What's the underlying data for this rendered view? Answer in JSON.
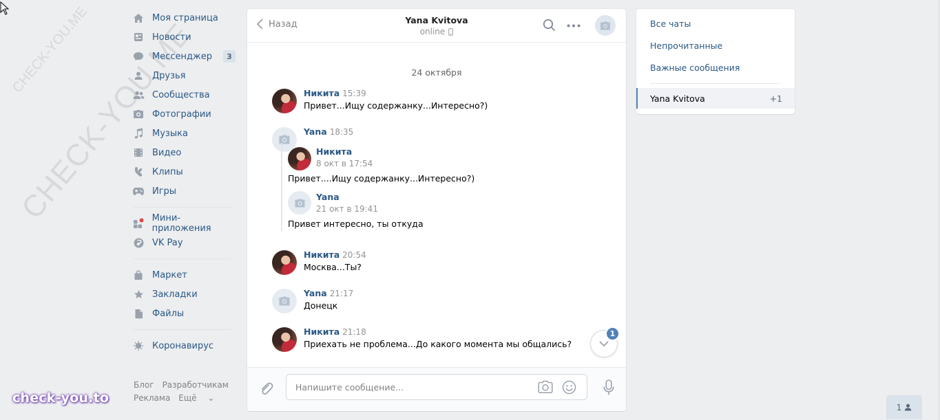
{
  "watermark": {
    "small": "CHECK-YOU.ME",
    "large": "CHECK-YOU.ME",
    "bottom": "check-you.to"
  },
  "nav": {
    "items": [
      {
        "label": "Моя страница",
        "icon": "home-icon"
      },
      {
        "label": "Новости",
        "icon": "news-icon"
      },
      {
        "label": "Мессенджер",
        "icon": "messenger-icon",
        "badge": "3"
      },
      {
        "label": "Друзья",
        "icon": "friends-icon"
      },
      {
        "label": "Сообщества",
        "icon": "communities-icon"
      },
      {
        "label": "Фотографии",
        "icon": "photos-icon"
      },
      {
        "label": "Музыка",
        "icon": "music-icon"
      },
      {
        "label": "Видео",
        "icon": "video-icon"
      },
      {
        "label": "Клипы",
        "icon": "clips-icon"
      },
      {
        "label": "Игры",
        "icon": "games-icon"
      }
    ],
    "items2": [
      {
        "label": "Мини-приложения",
        "icon": "mini-apps-icon"
      },
      {
        "label": "VK Pay",
        "icon": "vkpay-icon"
      }
    ],
    "items3": [
      {
        "label": "Маркет",
        "icon": "market-icon"
      },
      {
        "label": "Закладки",
        "icon": "bookmarks-icon"
      },
      {
        "label": "Файлы",
        "icon": "files-icon"
      }
    ],
    "items4": [
      {
        "label": "Коронавирус",
        "icon": "coronavirus-icon"
      }
    ],
    "footer": {
      "blog": "Блог",
      "developers": "Разработчикам",
      "ads": "Реклама",
      "more": "Ещё"
    }
  },
  "chat": {
    "back_label": "Назад",
    "peer_name": "Yana Kvitova",
    "peer_status": "online",
    "date_separator": "24 октября",
    "messages": [
      {
        "author": "Никита",
        "time": "15:39",
        "text": "Привет...Ищу содержанку...Интересно?)"
      },
      {
        "author": "Yana",
        "time": "18:35",
        "text": ""
      },
      {
        "author": "Никита",
        "time": "20:54",
        "text": "Москва...Ты?"
      },
      {
        "author": "Yana",
        "time": "21:17",
        "text": "Донецк"
      },
      {
        "author": "Никита",
        "time": "21:18",
        "text": "Приехать не проблема...До какого момента мы общались?"
      }
    ],
    "forwarded": [
      {
        "author": "Никита",
        "date": "8 окт в 17:54",
        "text": "Привет....Ищу содержанку...Интересно?)"
      },
      {
        "author": "Yana",
        "date": "21 окт в 19:41",
        "text": "Привет интересно, ты откуда"
      }
    ],
    "unread_badge": "1",
    "composer_placeholder": "Напишите сообщение..."
  },
  "right_panel": {
    "all_chats": "Все чаты",
    "unread": "Непрочитанные",
    "important": "Важные сообщения",
    "active_chat": "Yana Kvitova",
    "active_count": "+1"
  },
  "mini_chat_count": "1",
  "colors": {
    "link": "#2a5885",
    "accent": "#5181b8",
    "background": "#edeef0"
  }
}
